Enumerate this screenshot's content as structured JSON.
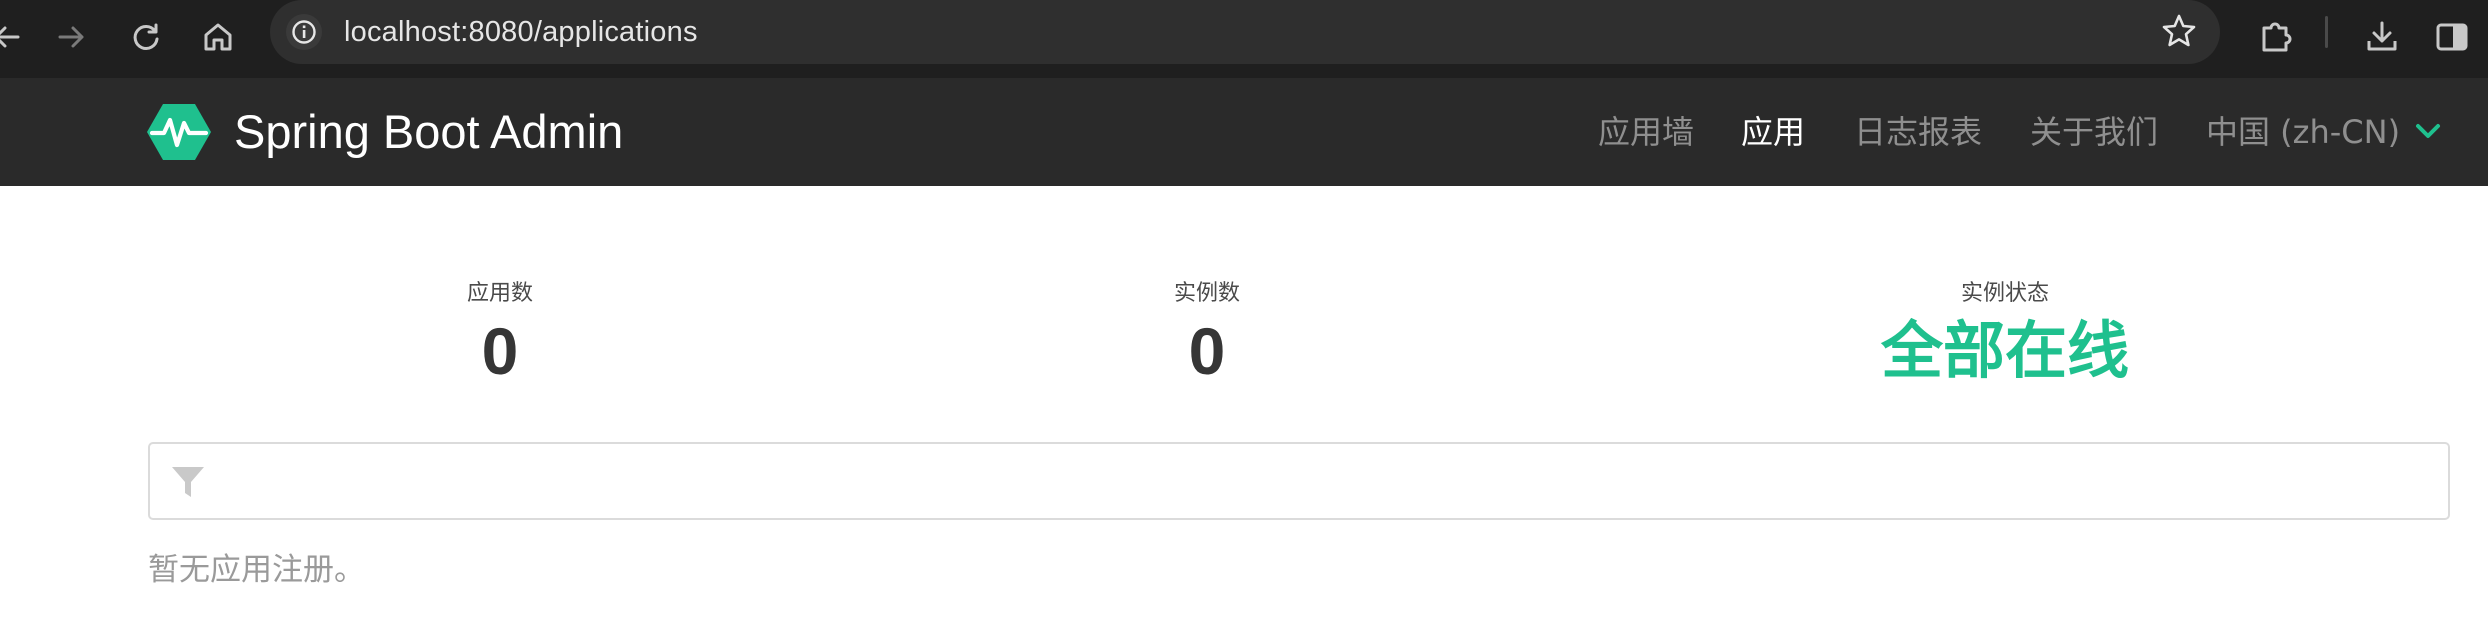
{
  "browser": {
    "url": "localhost:8080/applications",
    "icons": {
      "back": "arrow-left-icon",
      "forward": "arrow-right-icon",
      "reload": "reload-icon",
      "home": "home-icon",
      "info": "info-icon",
      "bookmark": "star-icon",
      "extensions": "puzzle-icon",
      "downloads": "download-icon",
      "sidepanel": "side-panel-icon"
    }
  },
  "navbar": {
    "brand": "Spring Boot Admin",
    "items": [
      {
        "label": "应用墙",
        "active": false
      },
      {
        "label": "应用",
        "active": true
      },
      {
        "label": "日志报表",
        "active": false
      },
      {
        "label": "关于我们",
        "active": false
      }
    ],
    "language": "中国 (zh-CN)",
    "colors": {
      "background": "#2a2a2a",
      "accent": "#1fc08e"
    }
  },
  "stats": {
    "applications_label": "应用数",
    "applications_value": "0",
    "instances_label": "实例数",
    "instances_value": "0",
    "status_label": "实例状态",
    "status_value": "全部在线"
  },
  "filter": {
    "placeholder": "",
    "value": ""
  },
  "empty_message": "暂无应用注册。"
}
